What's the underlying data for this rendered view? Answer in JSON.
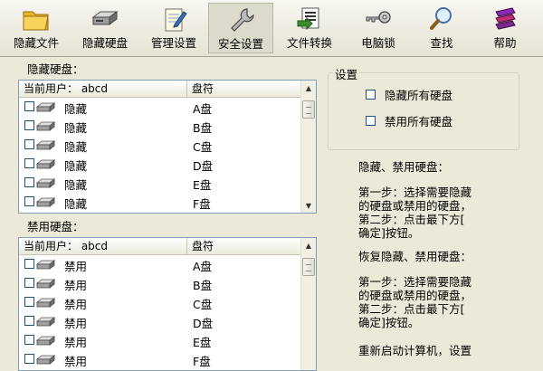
{
  "toolbar": {
    "items": [
      {
        "label": "隐藏文件",
        "icon": "folder-icon"
      },
      {
        "label": "隐藏硬盘",
        "icon": "hard-disk-icon"
      },
      {
        "label": "管理设置",
        "icon": "notepad-icon"
      },
      {
        "label": "安全设置",
        "icon": "wrench-icon"
      },
      {
        "label": "文件转换",
        "icon": "document-convert-icon"
      },
      {
        "label": "电脑锁",
        "icon": "key-icon"
      },
      {
        "label": "查找",
        "icon": "magnifier-icon"
      },
      {
        "label": "帮助",
        "icon": "books-icon"
      }
    ]
  },
  "hidden_disks": {
    "title": "隐藏硬盘：",
    "columns": [
      "当前用户： abcd",
      "盘符"
    ],
    "rows": [
      {
        "name": "隐藏",
        "drive": "A盘"
      },
      {
        "name": "隐藏",
        "drive": "B盘"
      },
      {
        "name": "隐藏",
        "drive": "C盘"
      },
      {
        "name": "隐藏",
        "drive": "D盘"
      },
      {
        "name": "隐藏",
        "drive": "E盘"
      },
      {
        "name": "隐藏",
        "drive": "F盘"
      }
    ]
  },
  "disabled_disks": {
    "title": "禁用硬盘：",
    "columns": [
      "当前用户： abcd",
      "盘符"
    ],
    "rows": [
      {
        "name": "禁用",
        "drive": "A盘"
      },
      {
        "name": "禁用",
        "drive": "B盘"
      },
      {
        "name": "禁用",
        "drive": "C盘"
      },
      {
        "name": "禁用",
        "drive": "D盘"
      },
      {
        "name": "禁用",
        "drive": "E盘"
      },
      {
        "name": "禁用",
        "drive": "F盘"
      }
    ]
  },
  "settings": {
    "title": "设置",
    "hide_all_label": "隐藏所有硬盘",
    "disable_all_label": "禁用所有硬盘"
  },
  "instructions": {
    "heading1": "隐藏、禁用硬盘：",
    "steps1": "第一步：选择需要隐藏\n的硬盘或禁用的硬盘，\n第二步：点击最下方[\n确定]按钮。",
    "heading2": "恢复隐藏、禁用硬盘：",
    "steps2": "第一步：选择需要隐藏\n的硬盘或禁用的硬盘，\n第二步：点击最下方[\n确定]按钮。",
    "footer": "重新启动计算机，设置"
  },
  "colors": {
    "window_bg": "#ece9d8",
    "list_border": "#7f9db9",
    "checkbox_border": "#1c5180"
  }
}
